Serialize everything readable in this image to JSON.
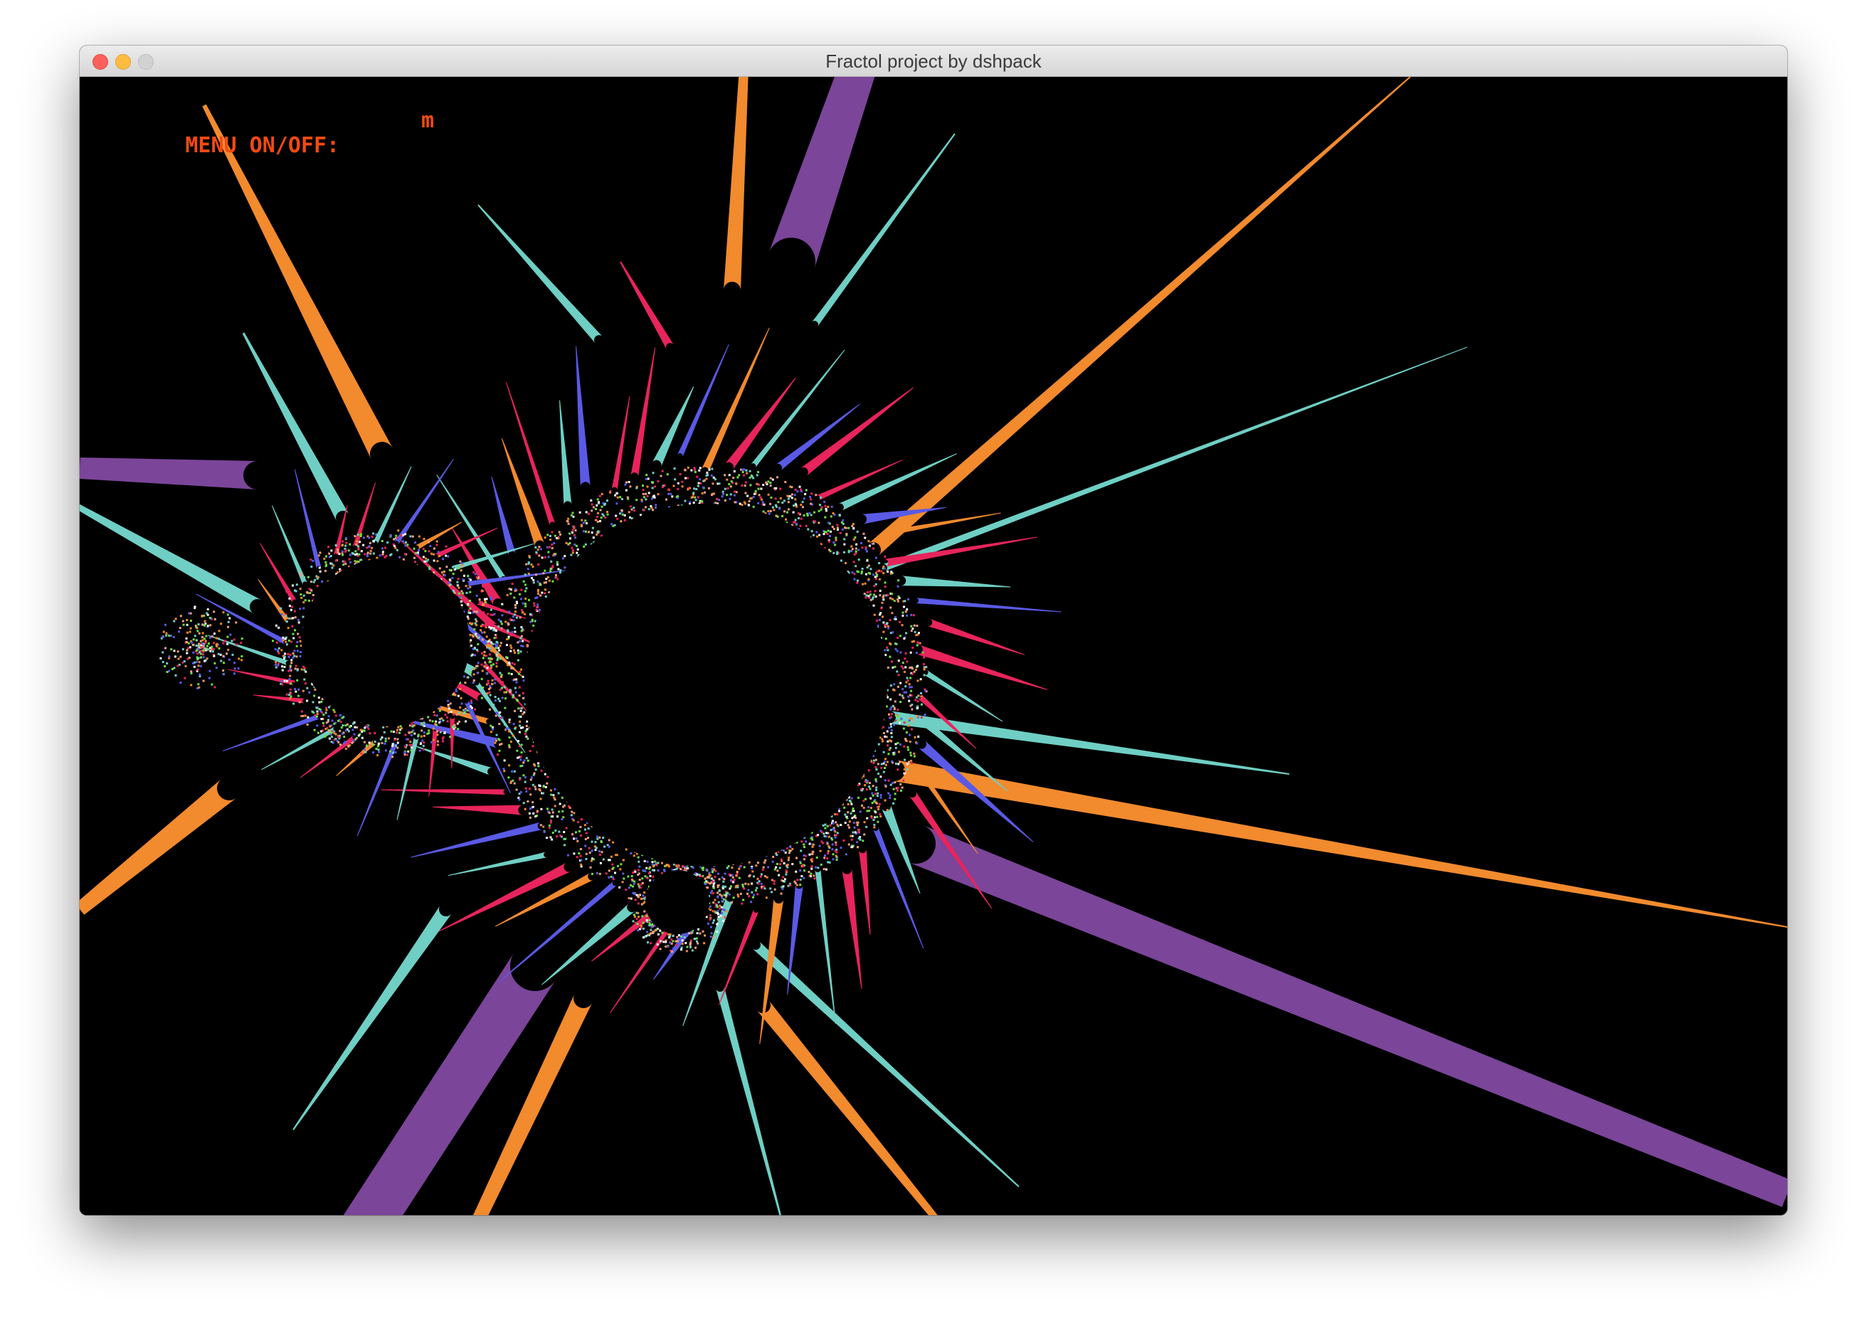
{
  "window": {
    "title": "Fractol project by dshpack"
  },
  "overlay": {
    "menu_label": "MENU ON/OFF:",
    "menu_key": "m"
  },
  "palette": {
    "orange": "#f28a2e",
    "purple": "#7b4599",
    "teal": "#6fcfc4",
    "pink": "#e8245c",
    "blue": "#5a5ae6",
    "green": "#6ce040",
    "peach": "#f0a080",
    "text": "#f24a12"
  }
}
